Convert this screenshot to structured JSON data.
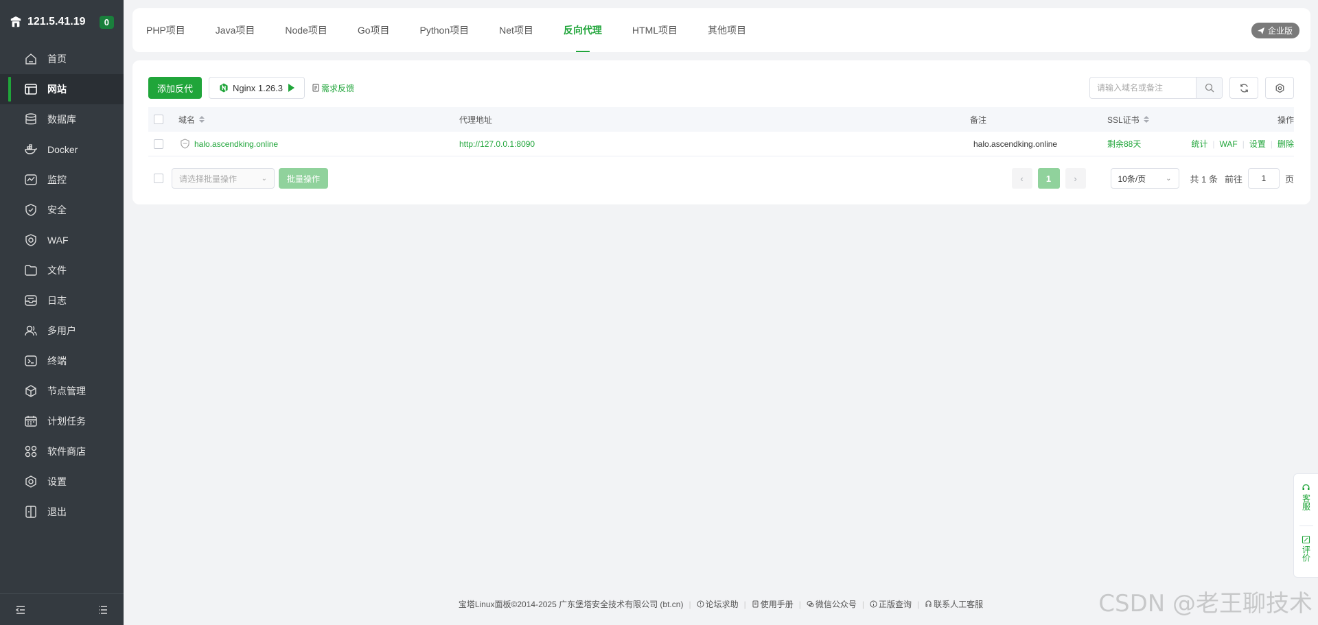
{
  "sidebar": {
    "ip": "121.5.41.19",
    "badge": "0",
    "items": [
      {
        "label": "首页",
        "icon": "home-icon"
      },
      {
        "label": "网站",
        "icon": "website-icon",
        "active": true
      },
      {
        "label": "数据库",
        "icon": "database-icon"
      },
      {
        "label": "Docker",
        "icon": "docker-icon"
      },
      {
        "label": "监控",
        "icon": "monitor-icon"
      },
      {
        "label": "安全",
        "icon": "shield-icon"
      },
      {
        "label": "WAF",
        "icon": "waf-icon"
      },
      {
        "label": "文件",
        "icon": "folder-icon"
      },
      {
        "label": "日志",
        "icon": "log-icon"
      },
      {
        "label": "多用户",
        "icon": "users-icon"
      },
      {
        "label": "终端",
        "icon": "terminal-icon"
      },
      {
        "label": "节点管理",
        "icon": "node-icon"
      },
      {
        "label": "计划任务",
        "icon": "calendar-icon"
      },
      {
        "label": "软件商店",
        "icon": "apps-icon"
      },
      {
        "label": "设置",
        "icon": "gear-icon"
      },
      {
        "label": "退出",
        "icon": "logout-icon"
      }
    ]
  },
  "tabs": [
    {
      "label": "PHP项目"
    },
    {
      "label": "Java项目"
    },
    {
      "label": "Node项目"
    },
    {
      "label": "Go项目"
    },
    {
      "label": "Python项目"
    },
    {
      "label": "Net项目"
    },
    {
      "label": "反向代理",
      "active": true
    },
    {
      "label": "HTML项目"
    },
    {
      "label": "其他项目"
    }
  ],
  "enterprise_label": "企业版",
  "toolbar": {
    "add_label": "添加反代",
    "nginx_label": "Nginx 1.26.3",
    "feedback_label": "需求反馈",
    "search_placeholder": "请输入域名或备注"
  },
  "table": {
    "headers": {
      "domain": "域名",
      "proxy": "代理地址",
      "remark": "备注",
      "ssl": "SSL证书",
      "ops": "操作"
    },
    "rows": [
      {
        "domain": "halo.ascendking.online",
        "proxy": "http://127.0.0.1:8090",
        "remark": "halo.ascendking.online",
        "ssl": "剩余88天",
        "ops": [
          "统计",
          "WAF",
          "设置",
          "删除"
        ]
      }
    ]
  },
  "pager": {
    "batch_placeholder": "请选择批量操作",
    "batch_button": "批量操作",
    "current_page": "1",
    "per_page": "10条/页",
    "total_text": "共 1 条",
    "goto_label": "前往",
    "goto_value": "1",
    "page_unit": "页"
  },
  "float_tools": {
    "service": "客服",
    "review": "评价"
  },
  "footer": {
    "copyright": "宝塔Linux面板©2014-2025 广东堡塔安全技术有限公司 (bt.cn)",
    "forum": "论坛求助",
    "manual": "使用手册",
    "wechat": "微信公众号",
    "verify": "正版查询",
    "support": "联系人工客服"
  },
  "watermark": "CSDN @老王聊技术",
  "colors": {
    "accent": "#20a53a",
    "sidebar_bg": "#343a40"
  }
}
